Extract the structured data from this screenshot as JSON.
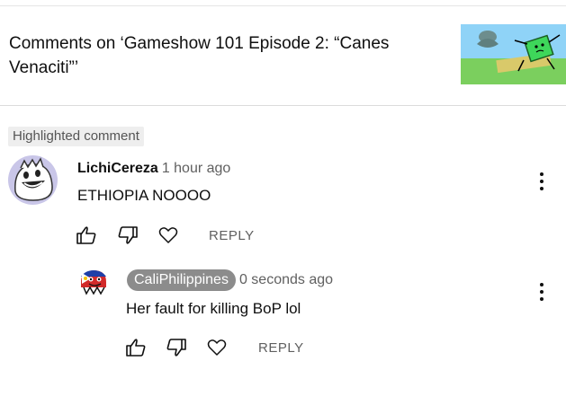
{
  "header": {
    "title": "Comments on ‘Gameshow 101 Episode 2: “Canes Venaciti”’",
    "thumbnail_icon": "video-thumbnail"
  },
  "highlighted_label": "Highlighted comment",
  "comment": {
    "author": "LichiCereza",
    "time": "1 hour ago",
    "text": "ETHIOPIA NOOOO",
    "reply_label": "REPLY"
  },
  "reply": {
    "author": "CaliPhilippines",
    "time": "0 seconds ago",
    "text": "Her fault for killing BoP lol",
    "reply_label": "REPLY"
  },
  "icons": {
    "like": "thumbs-up-icon",
    "dislike": "thumbs-down-icon",
    "heart": "heart-icon",
    "more": "more-vertical-icon"
  },
  "colors": {
    "author_chip_bg": "#8c8c8c",
    "badge_bg": "#eeeeee",
    "muted_text": "#606060"
  }
}
